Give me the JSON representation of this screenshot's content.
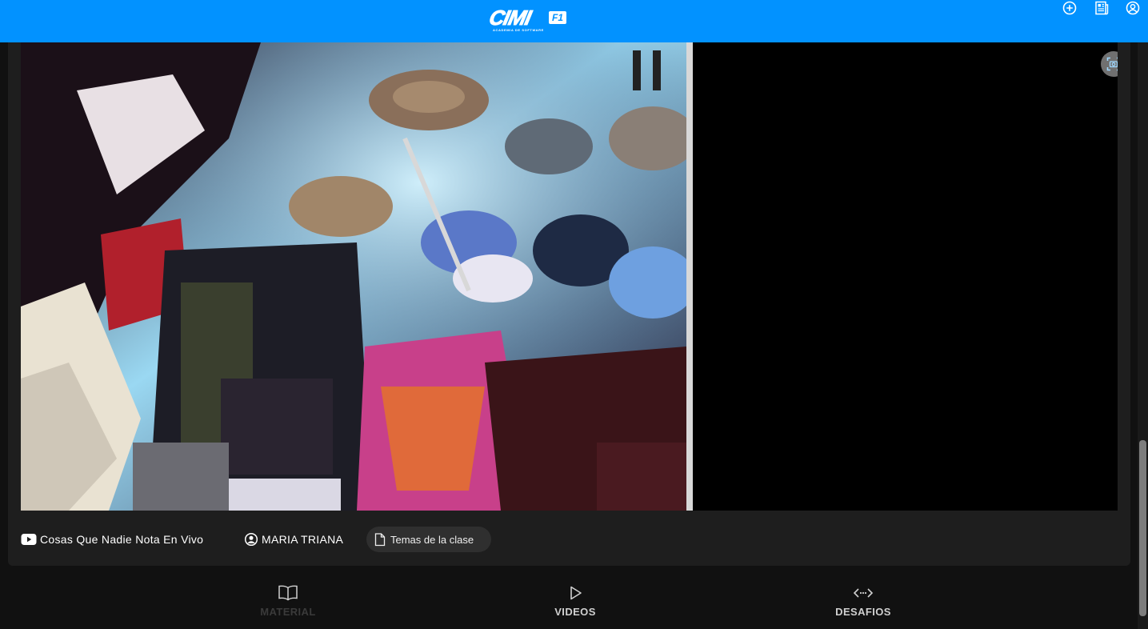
{
  "header": {
    "logo_text": "CIMI",
    "logo_badge": "F1",
    "logo_subtitle": "ACADEMIA DE SOFTWARE",
    "icons": [
      "add-circle-icon",
      "newspaper-icon",
      "account-circle-icon"
    ]
  },
  "video": {
    "camera_icon": "screenshot-camera-icon"
  },
  "meta": {
    "video_title": "Cosas Que Nadie Nota En Vivo",
    "instructor": "MARIA TRIANA",
    "topics_label": "Temas de la clase"
  },
  "nav": {
    "tabs": [
      {
        "label": "MATERIAL",
        "icon": "book-open-icon",
        "color": "#3a3a3a"
      },
      {
        "label": "VIDEOS",
        "icon": "play-icon",
        "color": "#d0d0d0"
      },
      {
        "label": "DESAFIOS",
        "icon": "code-arrows-icon",
        "color": "#d0d0d0"
      }
    ]
  },
  "colors": {
    "header_bg": "#0292ff",
    "page_bg": "#111111",
    "card_bg": "#1e1e1e",
    "chip_bg": "#2f2f2f"
  }
}
